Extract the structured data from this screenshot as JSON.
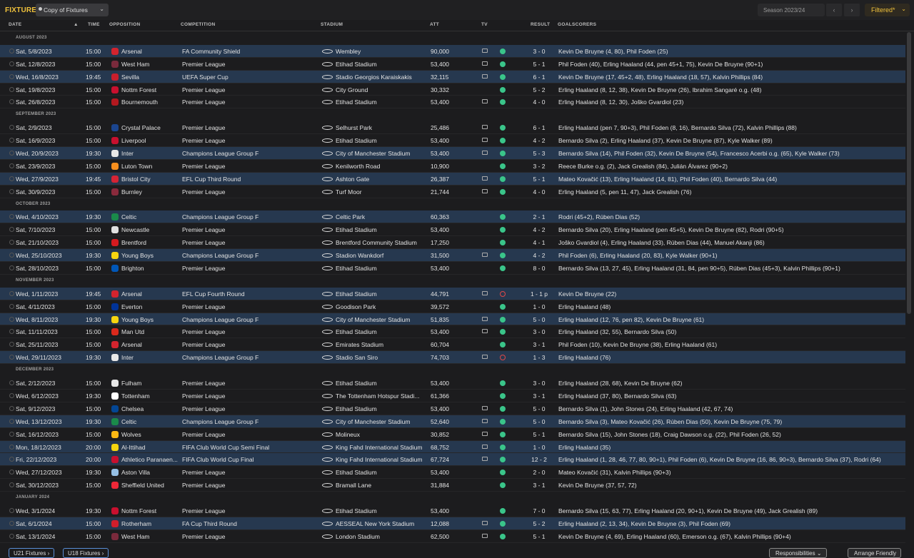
{
  "topbar": {
    "title": "FIXTURES",
    "view_dropdown": "Copy of Fixtures",
    "season": "Season 2023/24",
    "filter": "Filtered*"
  },
  "columns": {
    "date": "DATE",
    "time": "TIME",
    "opposition": "OPPOSITION",
    "competition": "COMPETITION",
    "stadium": "STADIUM",
    "att": "ATT",
    "tv": "TV",
    "result": "RESULT",
    "goalscorers": "GOALSCORERS"
  },
  "months": [
    "AUGUST 2023",
    "SEPTEMBER 2023",
    "OCTOBER 2023",
    "NOVEMBER 2023",
    "DECEMBER 2023",
    "JANUARY 2024"
  ],
  "fixtures": [
    {
      "m": 0,
      "date": "Sat, 5/8/2023",
      "time": "15:00",
      "opp": "Arsenal",
      "crest": "#d3242e",
      "comp": "FA Community Shield",
      "stadium": "Wembley",
      "att": "90,000",
      "tv": true,
      "win": true,
      "result": "3 - 0",
      "goals": "Kevin De Bruyne (4, 80), Phil Foden (25)",
      "hl": true
    },
    {
      "m": 0,
      "date": "Sat, 12/8/2023",
      "time": "15:00",
      "opp": "West Ham",
      "crest": "#7a2a3c",
      "comp": "Premier League",
      "stadium": "Etihad Stadium",
      "att": "53,400",
      "tv": true,
      "win": true,
      "result": "5 - 1",
      "goals": "Phil Foden (40), Erling Haaland (44, pen 45+1, 75), Kevin De Bruyne (90+1)",
      "hl": false
    },
    {
      "m": 0,
      "date": "Wed, 16/8/2023",
      "time": "19:45",
      "opp": "Sevilla",
      "crest": "#c91f2c",
      "comp": "UEFA Super Cup",
      "stadium": "Stadio Georgios Karaiskakis",
      "att": "32,115",
      "tv": true,
      "win": true,
      "result": "6 - 1",
      "goals": "Kevin De Bruyne (17, 45+2, 48), Erling Haaland (18, 57), Kalvin Phillips (84)",
      "hl": true
    },
    {
      "m": 0,
      "date": "Sat, 19/8/2023",
      "time": "15:00",
      "opp": "Nottm Forest",
      "crest": "#c8102e",
      "comp": "Premier League",
      "stadium": "City Ground",
      "att": "30,332",
      "tv": false,
      "win": true,
      "result": "5 - 2",
      "goals": "Erling Haaland (8, 12, 38), Kevin De Bruyne (26), Ibrahim Sangaré o.g. (48)",
      "hl": false
    },
    {
      "m": 0,
      "date": "Sat, 26/8/2023",
      "time": "15:00",
      "opp": "Bournemouth",
      "crest": "#b3181f",
      "comp": "Premier League",
      "stadium": "Etihad Stadium",
      "att": "53,400",
      "tv": true,
      "win": true,
      "result": "4 - 0",
      "goals": "Erling Haaland (8, 12, 30), Joško Gvardiol (23)",
      "hl": false
    },
    {
      "m": 1,
      "date": "Sat, 2/9/2023",
      "time": "15:00",
      "opp": "Crystal Palace",
      "crest": "#1b458f",
      "comp": "Premier League",
      "stadium": "Selhurst Park",
      "att": "25,486",
      "tv": true,
      "win": true,
      "result": "6 - 1",
      "goals": "Erling Haaland (pen 7, 90+3), Phil Foden (8, 16), Bernardo Silva (72), Kalvin Phillips (88)",
      "hl": false
    },
    {
      "m": 1,
      "date": "Sat, 16/9/2023",
      "time": "15:00",
      "opp": "Liverpool",
      "crest": "#c8102e",
      "comp": "Premier League",
      "stadium": "Etihad Stadium",
      "att": "53,400",
      "tv": true,
      "win": true,
      "result": "4 - 2",
      "goals": "Bernardo Silva (2), Erling Haaland (37), Kevin De Bruyne (87), Kyle Walker (89)",
      "hl": false
    },
    {
      "m": 1,
      "date": "Wed, 20/9/2023",
      "time": "19:30",
      "opp": "Inter",
      "crest": "#e8e8e8",
      "comp": "Champions League Group F",
      "stadium": "City of Manchester Stadium",
      "att": "53,400",
      "tv": true,
      "win": true,
      "result": "5 - 3",
      "goals": "Bernardo Silva (14), Phil Foden (32), Kevin De Bruyne (54), Francesco Acerbi o.g. (65), Kyle Walker (73)",
      "hl": true
    },
    {
      "m": 1,
      "date": "Sat, 23/9/2023",
      "time": "15:00",
      "opp": "Luton Town",
      "crest": "#f78f1e",
      "comp": "Premier League",
      "stadium": "Kenilworth Road",
      "att": "10,900",
      "tv": false,
      "win": true,
      "result": "3 - 2",
      "goals": "Reece Burke o.g. (2), Jack Grealish (84), Julián Álvarez (90+2)",
      "hl": false
    },
    {
      "m": 1,
      "date": "Wed, 27/9/2023",
      "time": "19:45",
      "opp": "Bristol City",
      "crest": "#d52434",
      "comp": "EFL Cup Third Round",
      "stadium": "Ashton Gate",
      "att": "26,387",
      "tv": true,
      "win": true,
      "result": "5 - 1",
      "goals": "Mateo Kovačić (13), Erling Haaland (14, 81), Phil Foden (40), Bernardo Silva (44)",
      "hl": true
    },
    {
      "m": 1,
      "date": "Sat, 30/9/2023",
      "time": "15:00",
      "opp": "Burnley",
      "crest": "#8a2a3c",
      "comp": "Premier League",
      "stadium": "Turf Moor",
      "att": "21,744",
      "tv": true,
      "win": true,
      "result": "4 - 0",
      "goals": "Erling Haaland (5, pen 11, 47), Jack Grealish (76)",
      "hl": false
    },
    {
      "m": 2,
      "date": "Wed, 4/10/2023",
      "time": "19:30",
      "opp": "Celtic",
      "crest": "#1a8a4a",
      "comp": "Champions League Group F",
      "stadium": "Celtic Park",
      "att": "60,363",
      "tv": false,
      "win": true,
      "result": "2 - 1",
      "goals": "Rodri (45+2), Rúben Dias (52)",
      "hl": true
    },
    {
      "m": 2,
      "date": "Sat, 7/10/2023",
      "time": "15:00",
      "opp": "Newcastle",
      "crest": "#e0e0e0",
      "comp": "Premier League",
      "stadium": "Etihad Stadium",
      "att": "53,400",
      "tv": false,
      "win": true,
      "result": "4 - 2",
      "goals": "Bernardo Silva (20), Erling Haaland (pen 45+5), Kevin De Bruyne (82), Rodri (90+5)",
      "hl": false
    },
    {
      "m": 2,
      "date": "Sat, 21/10/2023",
      "time": "15:00",
      "opp": "Brentford",
      "crest": "#d41a1f",
      "comp": "Premier League",
      "stadium": "Brentford Community Stadium",
      "att": "17,250",
      "tv": false,
      "win": true,
      "result": "4 - 1",
      "goals": "Joško Gvardiol (4), Erling Haaland (33), Rúben Dias (44), Manuel Akanji (86)",
      "hl": false
    },
    {
      "m": 2,
      "date": "Wed, 25/10/2023",
      "time": "19:30",
      "opp": "Young Boys",
      "crest": "#f5d40f",
      "comp": "Champions League Group F",
      "stadium": "Stadion Wankdorf",
      "att": "31,500",
      "tv": true,
      "win": true,
      "result": "4 - 2",
      "goals": "Phil Foden (6), Erling Haaland (20, 83), Kyle Walker (90+1)",
      "hl": true
    },
    {
      "m": 2,
      "date": "Sat, 28/10/2023",
      "time": "15:00",
      "opp": "Brighton",
      "crest": "#0057b8",
      "comp": "Premier League",
      "stadium": "Etihad Stadium",
      "att": "53,400",
      "tv": false,
      "win": true,
      "result": "8 - 0",
      "goals": "Bernardo Silva (13, 27, 45), Erling Haaland (31, 84, pen 90+5), Rúben Dias (45+3), Kalvin Phillips (90+1)",
      "hl": false
    },
    {
      "m": 3,
      "date": "Wed, 1/11/2023",
      "time": "19:45",
      "opp": "Arsenal",
      "crest": "#d3242e",
      "comp": "EFL Cup Fourth Round",
      "stadium": "Etihad Stadium",
      "att": "44,791",
      "tv": true,
      "win": false,
      "result": "1 - 1 p",
      "goals": "Kevin De Bruyne (22)",
      "hl": true
    },
    {
      "m": 3,
      "date": "Sat, 4/11/2023",
      "time": "15:00",
      "opp": "Everton",
      "crest": "#003399",
      "comp": "Premier League",
      "stadium": "Goodison Park",
      "att": "39,572",
      "tv": false,
      "win": true,
      "result": "1 - 0",
      "goals": "Erling Haaland (48)",
      "hl": false
    },
    {
      "m": 3,
      "date": "Wed, 8/11/2023",
      "time": "19:30",
      "opp": "Young Boys",
      "crest": "#f5d40f",
      "comp": "Champions League Group F",
      "stadium": "City of Manchester Stadium",
      "att": "51,835",
      "tv": true,
      "win": true,
      "result": "5 - 0",
      "goals": "Erling Haaland (12, 76, pen 82), Kevin De Bruyne (61)",
      "hl": true
    },
    {
      "m": 3,
      "date": "Sat, 11/11/2023",
      "time": "15:00",
      "opp": "Man Utd",
      "crest": "#da291c",
      "comp": "Premier League",
      "stadium": "Etihad Stadium",
      "att": "53,400",
      "tv": true,
      "win": true,
      "result": "3 - 0",
      "goals": "Erling Haaland (32, 55), Bernardo Silva (50)",
      "hl": false
    },
    {
      "m": 3,
      "date": "Sat, 25/11/2023",
      "time": "15:00",
      "opp": "Arsenal",
      "crest": "#d3242e",
      "comp": "Premier League",
      "stadium": "Emirates Stadium",
      "att": "60,704",
      "tv": false,
      "win": true,
      "result": "3 - 1",
      "goals": "Phil Foden (10), Kevin De Bruyne (38), Erling Haaland (61)",
      "hl": false
    },
    {
      "m": 3,
      "date": "Wed, 29/11/2023",
      "time": "19:30",
      "opp": "Inter",
      "crest": "#e8e8e8",
      "comp": "Champions League Group F",
      "stadium": "Stadio San Siro",
      "att": "74,703",
      "tv": true,
      "win": false,
      "result": "1 - 3",
      "goals": "Erling Haaland (76)",
      "hl": true
    },
    {
      "m": 4,
      "date": "Sat, 2/12/2023",
      "time": "15:00",
      "opp": "Fulham",
      "crest": "#e8e8e8",
      "comp": "Premier League",
      "stadium": "Etihad Stadium",
      "att": "53,400",
      "tv": false,
      "win": true,
      "result": "3 - 0",
      "goals": "Erling Haaland (28, 68), Kevin De Bruyne (62)",
      "hl": false
    },
    {
      "m": 4,
      "date": "Wed, 6/12/2023",
      "time": "19:30",
      "opp": "Tottenham",
      "crest": "#ffffff",
      "comp": "Premier League",
      "stadium": "The Tottenham Hotspur Stadi...",
      "att": "61,366",
      "tv": false,
      "win": true,
      "result": "3 - 1",
      "goals": "Erling Haaland (37, 80), Bernardo Silva (63)",
      "hl": false
    },
    {
      "m": 4,
      "date": "Sat, 9/12/2023",
      "time": "15:00",
      "opp": "Chelsea",
      "crest": "#034694",
      "comp": "Premier League",
      "stadium": "Etihad Stadium",
      "att": "53,400",
      "tv": true,
      "win": true,
      "result": "5 - 0",
      "goals": "Bernardo Silva (1), John Stones (24), Erling Haaland (42, 67, 74)",
      "hl": false
    },
    {
      "m": 4,
      "date": "Wed, 13/12/2023",
      "time": "19:30",
      "opp": "Celtic",
      "crest": "#1a8a4a",
      "comp": "Champions League Group F",
      "stadium": "City of Manchester Stadium",
      "att": "52,640",
      "tv": true,
      "win": true,
      "result": "5 - 0",
      "goals": "Bernardo Silva (3), Mateo Kovačić (26), Rúben Dias (50), Kevin De Bruyne (75, 79)",
      "hl": true
    },
    {
      "m": 4,
      "date": "Sat, 16/12/2023",
      "time": "15:00",
      "opp": "Wolves",
      "crest": "#fdb913",
      "comp": "Premier League",
      "stadium": "Molineux",
      "att": "30,852",
      "tv": true,
      "win": true,
      "result": "5 - 1",
      "goals": "Bernardo Silva (15), John Stones (18), Craig Dawson o.g. (22), Phil Foden (26, 52)",
      "hl": false
    },
    {
      "m": 4,
      "date": "Mon, 18/12/2023",
      "time": "20:00",
      "opp": "Al-Ittihad",
      "crest": "#f5d40f",
      "comp": "FIFA Club World Cup Semi Final",
      "stadium": "King Fahd International Stadium",
      "att": "68,752",
      "tv": true,
      "win": true,
      "result": "1 - 0",
      "goals": "Erling Haaland (35)",
      "hl": true
    },
    {
      "m": 4,
      "date": "Fri, 22/12/2023",
      "time": "20:00",
      "opp": "Athletico Paranaen...",
      "crest": "#c8102e",
      "comp": "FIFA Club World Cup Final",
      "stadium": "King Fahd International Stadium",
      "att": "67,724",
      "tv": true,
      "win": true,
      "result": "12 - 2",
      "goals": "Erling Haaland (1, 28, 46, 77, 80, 90+1), Phil Foden (6), Kevin De Bruyne (16, 86, 90+3), Bernardo Silva (37), Rodri (64)",
      "hl": true
    },
    {
      "m": 4,
      "date": "Wed, 27/12/2023",
      "time": "19:30",
      "opp": "Aston Villa",
      "crest": "#95bfe5",
      "comp": "Premier League",
      "stadium": "Etihad Stadium",
      "att": "53,400",
      "tv": false,
      "win": true,
      "result": "2 - 0",
      "goals": "Mateo Kovačić (31), Kalvin Phillips (90+3)",
      "hl": false
    },
    {
      "m": 4,
      "date": "Sat, 30/12/2023",
      "time": "15:00",
      "opp": "Sheffield United",
      "crest": "#ee2737",
      "comp": "Premier League",
      "stadium": "Bramall Lane",
      "att": "31,884",
      "tv": false,
      "win": true,
      "result": "3 - 1",
      "goals": "Kevin De Bruyne (37, 57, 72)",
      "hl": false
    },
    {
      "m": 5,
      "date": "Wed, 3/1/2024",
      "time": "19:30",
      "opp": "Nottm Forest",
      "crest": "#c8102e",
      "comp": "Premier League",
      "stadium": "Etihad Stadium",
      "att": "53,400",
      "tv": false,
      "win": true,
      "result": "7 - 0",
      "goals": "Bernardo Silva (15, 63, 77), Erling Haaland (20, 90+1), Kevin De Bruyne (49), Jack Grealish (89)",
      "hl": false
    },
    {
      "m": 5,
      "date": "Sat, 6/1/2024",
      "time": "15:00",
      "opp": "Rotherham",
      "crest": "#d11e2b",
      "comp": "FA Cup Third Round",
      "stadium": "AESSEAL New York Stadium",
      "att": "12,088",
      "tv": true,
      "win": true,
      "result": "5 - 2",
      "goals": "Erling Haaland (2, 13, 34), Kevin De Bruyne (3), Phil Foden (69)",
      "hl": true
    },
    {
      "m": 5,
      "date": "Sat, 13/1/2024",
      "time": "15:00",
      "opp": "West Ham",
      "crest": "#7a2a3c",
      "comp": "Premier League",
      "stadium": "London Stadium",
      "att": "62,500",
      "tv": true,
      "win": true,
      "result": "5 - 1",
      "goals": "Kevin De Bruyne (4, 69), Erling Haaland (60), Emerson o.g. (67), Kalvin Phillips (90+4)",
      "hl": false
    }
  ],
  "footer": {
    "u21": "U21 Fixtures",
    "u18": "U18 Fixtures",
    "responsibilities": "Responsibilities",
    "arrange": "Arrange Friendly"
  }
}
